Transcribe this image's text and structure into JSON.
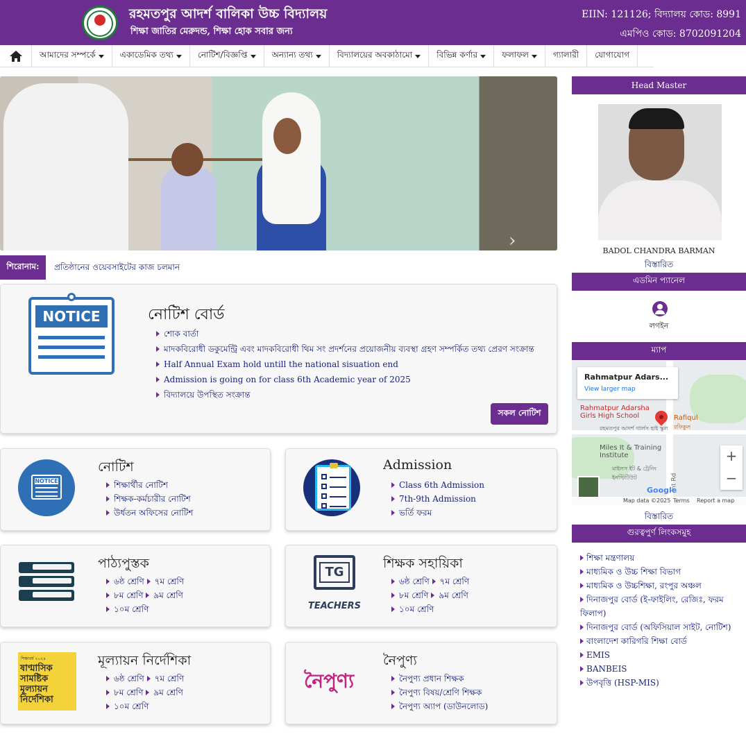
{
  "header": {
    "school_name": "রহমতপুর আদর্শ বালিকা উচ্চ বিদ্যালয়",
    "motto": "শিক্ষা জাতির মেরুদন্ড, শিক্ষা হোক সবার জন্য",
    "eiin": "EIIN: 121126; বিদ্যালয় কোড: 8991",
    "mpo": "এমপিও কোড: 8702091204",
    "brand_color": "#6b2d8f"
  },
  "nav": {
    "home_icon": "home-icon",
    "items": [
      {
        "label": "আমাদের সম্পর্কে",
        "dropdown": true
      },
      {
        "label": "একাডেমিক তথ্য",
        "dropdown": true
      },
      {
        "label": "নোটিশ/বিজ্ঞপ্তি",
        "dropdown": true
      },
      {
        "label": "অন্যান্য তথ্য",
        "dropdown": true
      },
      {
        "label": "বিদ্যালয়ের অবকাঠামো",
        "dropdown": true
      },
      {
        "label": "বিভিন্ন কর্ণার",
        "dropdown": true
      },
      {
        "label": "ফলাফল",
        "dropdown": true
      },
      {
        "label": "গ্যালারী",
        "dropdown": false
      },
      {
        "label": "যোগাযোগ",
        "dropdown": false
      }
    ]
  },
  "ticker": {
    "label": "শিরোনাম:",
    "text": "প্রতিষ্ঠানের ওয়েবসাইটের কাজ চলমান"
  },
  "notice_board": {
    "icon_text": "NOTICE",
    "title": "নোটিশ বোর্ড",
    "items": [
      "শোক বার্তা",
      "মাদকবিরোধী ডকুমেন্ট্রি এবং মাদকবিরোধী থিম সং প্রদর্শনের প্রয়োজনীয় ব্যবস্থা গ্রহণ সম্পর্কিত তথ্য প্রেরণ সংক্রান্ত",
      "Half Annual Exam hold untill the national sisuation end",
      "Admission is going on for class 6th Academic year of 2025",
      "বিদ্যালয়ে উপস্থিত সংক্রান্ত"
    ],
    "all_button": "সকল নোটিশ"
  },
  "cards": {
    "notice": {
      "title": "নোটিশ",
      "icon_text": "NOTICE",
      "items": [
        "শিক্ষার্থীর নোটিশ",
        "শিক্ষক-কর্মচারীর নোটিশ",
        "উর্ধতন অফিসের নোটিশ"
      ]
    },
    "admission": {
      "title": "Admission",
      "items": [
        "Class 6th Admission",
        "7th-9th Admission",
        "ভর্তি ফরম"
      ]
    },
    "textbook": {
      "title": "পাঠ্যপুস্তক",
      "rows": [
        [
          "৬ষ্ঠ শ্রেণি",
          "৭ম শ্রেণি"
        ],
        [
          "৮ম শ্রেণি",
          "৯ম শ্রেণি"
        ],
        [
          "১০ম শ্রেণি"
        ]
      ]
    },
    "teacher_guide": {
      "title": "শিক্ষক সহায়িকা",
      "icon_text": "TG",
      "icon_label": "TEACHERS",
      "rows": [
        [
          "৬ষ্ঠ শ্রেণি",
          "৭ম শ্রেণি"
        ],
        [
          "৮ম শ্রেণি",
          "৯ম শ্রেণি"
        ],
        [
          "১০ম শ্রেণি"
        ]
      ]
    },
    "evaluation": {
      "title": "মূল্যায়ন নির্দেশিকা",
      "icon_text_small": "শিক্ষাবর্ষ ২০২৪",
      "icon_text": "ষাণ্মাসিক সামষ্টিক মূল্যায়ন নির্দেশিকা",
      "rows": [
        [
          "৬ষ্ঠ শ্রেণি",
          "৭ম শ্রেণি"
        ],
        [
          "৮ম শ্রেণি",
          "৯ম শ্রেণি"
        ],
        [
          "১০ম শ্রেণি"
        ]
      ]
    },
    "nipun": {
      "title": "নৈপুণ্য",
      "icon_text": "নৈপুণ্য",
      "items": [
        "নৈপুণ্য প্রধান শিক্ষক",
        "নৈপুণ্য বিষয়/শ্রেণি শিক্ষক",
        "নৈপুণ্য অ্যাপ (ডাউনলোড)"
      ]
    }
  },
  "sidebar": {
    "head_master": {
      "heading": "Head Master",
      "name": "BADOL CHANDRA BARMAN",
      "link": "বিস্তারিত"
    },
    "admin": {
      "heading": "এডমিন প্যানেল",
      "login": "লগইন"
    },
    "map": {
      "heading": "ম্যাপ",
      "place": "Rahmatpur Adars...",
      "view_larger": "View larger map",
      "label_school": "Rahmatpur Adarsha Girls High School",
      "label_school_bn": "রহমতপুর আদর্শ গার্লস হাই স্কুল",
      "label_rafiqul": "Rafiqul",
      "label_rafiqul_bn": "রফিকুল",
      "label_miles": "Miles It & Training Institute",
      "label_miles_bn": "মাইলস ইট & ট্রেনিং ইনস্টিটিউট",
      "label_road": "Int Rd",
      "google": "Google",
      "footer_data": "Map data ©2025",
      "footer_terms": "Terms",
      "footer_report": "Report a map error",
      "zoom_in": "+",
      "zoom_out": "−",
      "link": "বিস্তারিত"
    },
    "links": {
      "heading": "গুরত্বপুর্ণ লিংকসমুহ",
      "items": [
        "শিক্ষা মন্ত্রণালয়",
        "মাধ্যমিক ও উচ্চ শিক্ষা বিভাগ",
        "মাধ্যমিক ও উচ্চশিক্ষা, রংপুর অঞ্চল",
        "দিনাজপুর বোর্ড (ই-ফাইলিং, রেজিঃ, ফরম ফিলাপ)",
        "দিনাজপুর বোর্ড (অফিসিয়াল সাইট, নোটিশ)",
        "বাংলাদেশ কারিগরি শিক্ষা বোর্ড",
        "EMIS",
        "BANBEIS",
        "উপবৃত্তি (HSP-MIS)"
      ]
    }
  }
}
